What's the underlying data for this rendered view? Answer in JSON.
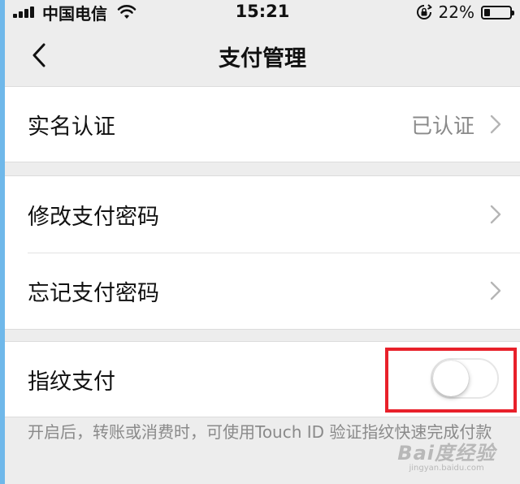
{
  "status_bar": {
    "carrier": "中国电信",
    "time": "15:21",
    "battery_percent": "22%",
    "battery_level": 0.22,
    "icons": [
      "signal-icon",
      "wifi-icon",
      "rotation-lock-icon",
      "battery-icon"
    ]
  },
  "nav": {
    "title": "支付管理",
    "back_icon": "chevron-left-icon"
  },
  "groups": {
    "identity": {
      "label": "实名认证",
      "value": "已认证"
    },
    "password": {
      "change_label": "修改支付密码",
      "forgot_label": "忘记支付密码"
    },
    "fingerprint": {
      "label": "指纹支付",
      "enabled": false,
      "description": "开启后，转账或消费时，可使用Touch ID 验证指纹快速完成付款"
    }
  },
  "annotation": {
    "highlight_color": "#e8202a"
  },
  "watermark": {
    "main": "Bai度经验",
    "sub": "jingyan.baidu.com"
  },
  "colors": {
    "background": "#ededed",
    "row_background": "#ffffff",
    "secondary_text": "#8a8a8a",
    "frame": "#6fb8ea"
  }
}
